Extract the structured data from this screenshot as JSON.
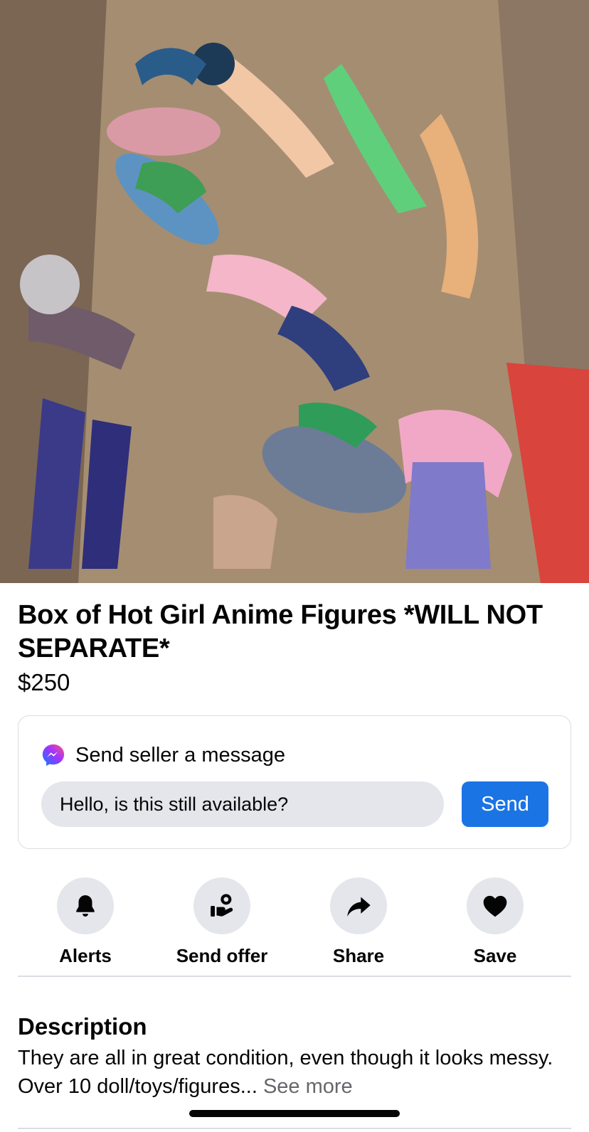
{
  "listing": {
    "title": "Box of Hot Girl Anime Figures *WILL NOT SEPARATE*",
    "price": "$250"
  },
  "message_card": {
    "heading": "Send seller a message",
    "input_value": "Hello, is this still available?",
    "send_label": "Send"
  },
  "actions": [
    {
      "label": "Alerts",
      "icon": "bell-icon"
    },
    {
      "label": "Send offer",
      "icon": "offer-icon"
    },
    {
      "label": "Share",
      "icon": "share-icon"
    },
    {
      "label": "Save",
      "icon": "heart-icon"
    }
  ],
  "description": {
    "heading": "Description",
    "text": "They are all in great condition, even though it looks messy. Over 10 doll/toys/figures...",
    "see_more": "See more"
  },
  "colors": {
    "accent": "#1b74e4",
    "icon_bg": "#e4e6eb",
    "muted_text": "#65676b"
  }
}
